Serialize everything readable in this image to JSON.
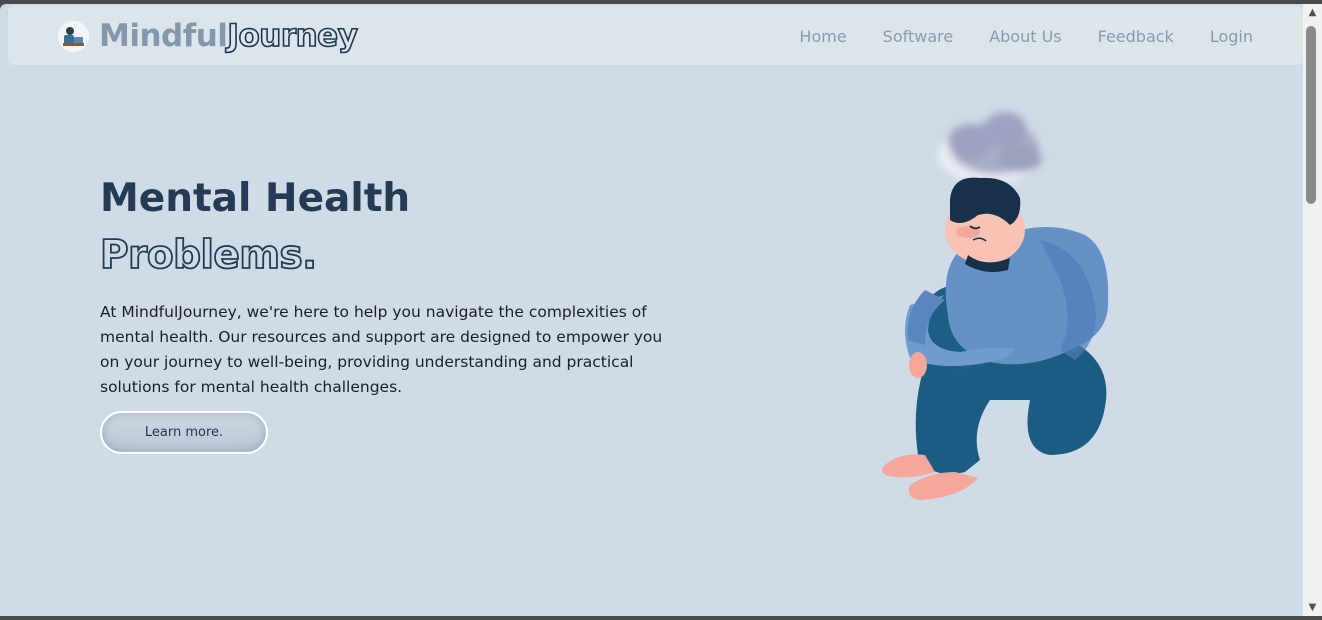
{
  "header": {
    "logo_part1": "Mindful",
    "logo_part2": "Journey",
    "nav": [
      "Home",
      "Software",
      "About Us",
      "Feedback",
      "Login"
    ]
  },
  "hero": {
    "title_line1": "Mental Health",
    "title_line2": "Problems.",
    "description": "At MindfulJourney, we're here to help you navigate the complexities of mental health. Our resources and support are designed to empower you on your journey to well-being, providing understanding and practical solutions for mental health challenges.",
    "cta_label": "Learn more."
  },
  "scrollbar": {
    "up_icon": "▲",
    "down_icon": "▼"
  },
  "colors": {
    "background": "#cfdbe7",
    "navbar": "#dce5ea",
    "heading": "#243a55",
    "nav_link": "#8a9bb0"
  }
}
